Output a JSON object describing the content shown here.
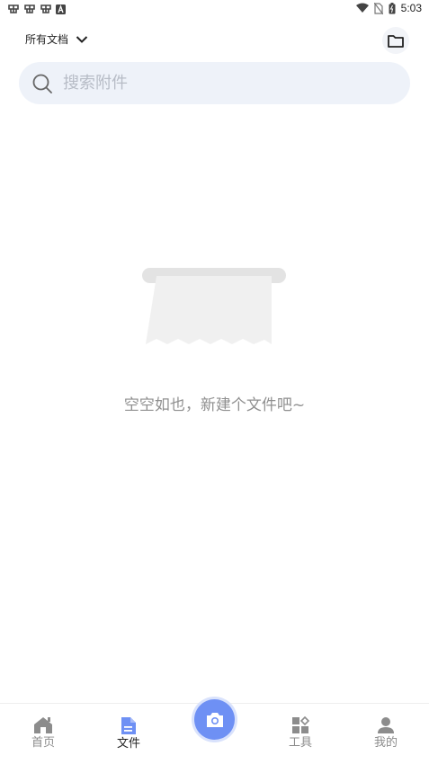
{
  "status_bar": {
    "time": "5:03",
    "icons_left": [
      "bug-icon",
      "bug-icon",
      "bug-icon",
      "a-icon"
    ],
    "icons_right": [
      "wifi-icon",
      "no-sim-icon",
      "battery-icon"
    ]
  },
  "header": {
    "filter_label": "所有文档",
    "folder_icon": "folder-icon"
  },
  "search": {
    "placeholder": "搜索附件",
    "value": ""
  },
  "empty_state": {
    "message": "空空如也，新建个文件吧~"
  },
  "bottom_nav": {
    "items": [
      {
        "label": "首页",
        "icon": "home-icon",
        "active": false
      },
      {
        "label": "文件",
        "icon": "file-icon",
        "active": true
      },
      {
        "label": "工具",
        "icon": "tools-icon",
        "active": false
      },
      {
        "label": "我的",
        "icon": "profile-icon",
        "active": false
      }
    ],
    "camera_icon": "camera-icon"
  },
  "colors": {
    "accent": "#6e90f4",
    "search_bg": "#eef2f9",
    "muted_text": "#8f8f8f",
    "icon_gray": "#9a9a9a"
  }
}
